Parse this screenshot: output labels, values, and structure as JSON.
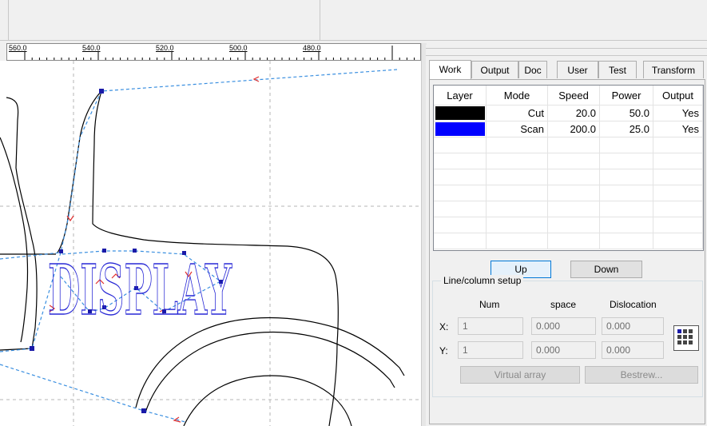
{
  "ruler": {
    "labels": [
      "560.0",
      "540.0",
      "520.0",
      "500.0",
      "480.0"
    ]
  },
  "canvas": {
    "design_text": "DISPLAY",
    "line_color": "#000000",
    "path_color": "#3a8fe0",
    "text_color": "#2a2ad6",
    "origin_marker_color": "#2ecc2e"
  },
  "tabs": [
    {
      "label": "Work",
      "active": true
    },
    {
      "label": "Output"
    },
    {
      "label": "Doc"
    },
    {
      "label": "User"
    },
    {
      "label": "Test"
    },
    {
      "label": "Transform"
    }
  ],
  "layers": {
    "headers": [
      "Layer",
      "Mode",
      "Speed",
      "Power",
      "Output"
    ],
    "rows": [
      {
        "color": "#000000",
        "mode": "Cut",
        "speed": "20.0",
        "power": "50.0",
        "output": "Yes"
      },
      {
        "color": "#0000ff",
        "mode": "Scan",
        "speed": "200.0",
        "power": "25.0",
        "output": "Yes"
      }
    ]
  },
  "buttons": {
    "up": "Up",
    "down": "Down",
    "virtual_array": "Virtual array",
    "bestrew": "Bestrew..."
  },
  "line_setup": {
    "title": "Line/column setup",
    "col_num": "Num",
    "col_space": "space",
    "col_dislocation": "Dislocation",
    "x_label": "X:",
    "y_label": "Y:",
    "x_num": "1",
    "x_space": "0.000",
    "x_dislocation": "0.000",
    "y_num": "1",
    "y_space": "0.000",
    "y_dislocation": "0.000"
  }
}
